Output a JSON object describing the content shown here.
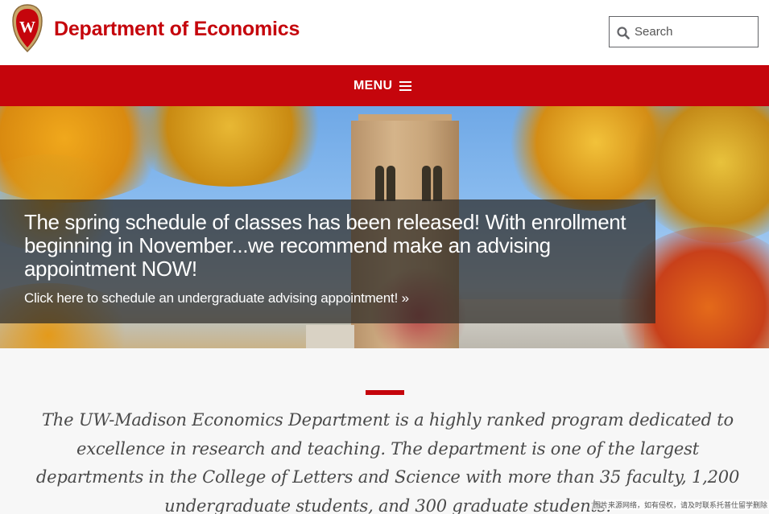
{
  "header": {
    "site_title": "Department of Economics",
    "search_placeholder": "Search"
  },
  "nav": {
    "menu_label": "MENU"
  },
  "hero": {
    "headline": "The spring schedule of classes has been released! With enrollment beginning in November...we recommend make an advising appointment NOW!",
    "link_text": "Click here to schedule an undergraduate advising appointment! »"
  },
  "intro": {
    "text": "The UW-Madison Economics Department is a highly ranked program dedicated to excellence in research and teaching. The department is one of the largest departments in the College of Letters and Science with more than 35 faculty, 1,200 undergraduate students, and 300 graduate students."
  },
  "watermark": "图片来源网络，如有侵权，请及时联系托普仕留学删除",
  "icons": {
    "logo": "uw-crest-icon",
    "search": "search-icon",
    "menu": "hamburger-icon"
  },
  "colors": {
    "brand_red": "#c5050c",
    "white": "#ffffff",
    "body_text": "#4a4a4a",
    "background": "#f7f7f7"
  }
}
